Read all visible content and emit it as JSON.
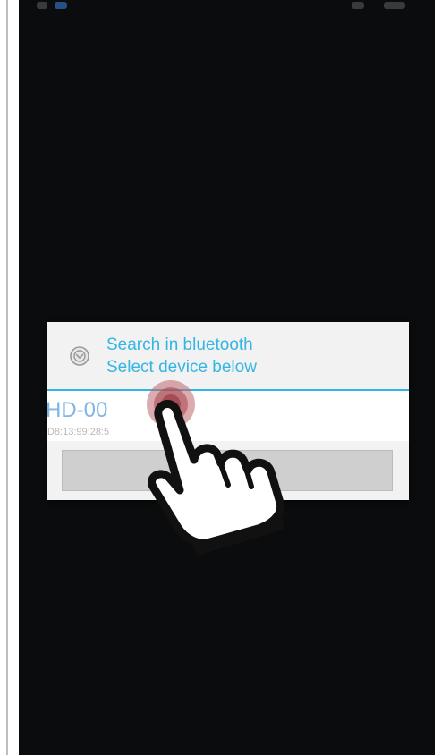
{
  "dialog": {
    "title": "Search in bluetooth",
    "subtitle": "Select device below",
    "icon": "bluetooth-search-icon",
    "accent_color": "#33b5e5"
  },
  "device_list": {
    "items": [
      {
        "name": "HD-00",
        "address": "D8:13:99:28:5"
      }
    ]
  },
  "overlay": {
    "gesture": "tap",
    "icons": [
      "touch-ripple-icon",
      "pointing-hand-icon"
    ]
  },
  "colors": {
    "screen_background": "#0b0c0d",
    "dialog_background": "#f2f2f2",
    "device_name": "#7fb6e6",
    "tap_ripple": "#c0666e"
  }
}
